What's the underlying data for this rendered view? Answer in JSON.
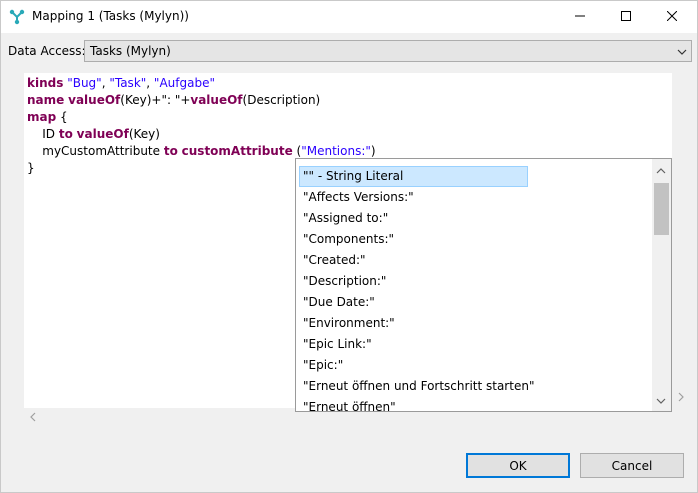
{
  "window": {
    "title": "Mapping 1 (Tasks (Mylyn))",
    "icon": "branch-connector-icon",
    "controls": [
      "minimize-icon",
      "maximize-icon",
      "close-icon"
    ]
  },
  "data_access": {
    "label": "Data Access:",
    "selected": "Tasks (Mylyn)"
  },
  "editor": {
    "lines": [
      [
        {
          "t": "kinds",
          "c": "kw"
        },
        {
          "t": " ",
          "c": "plain"
        },
        {
          "t": "\"Bug\"",
          "c": "str"
        },
        {
          "t": ", ",
          "c": "plain"
        },
        {
          "t": "\"Task\"",
          "c": "str"
        },
        {
          "t": ", ",
          "c": "plain"
        },
        {
          "t": "\"Aufgabe\"",
          "c": "str"
        }
      ],
      [
        {
          "t": "name",
          "c": "kw"
        },
        {
          "t": " ",
          "c": "plain"
        },
        {
          "t": "valueOf",
          "c": "kw"
        },
        {
          "t": "(Key)+\": \"+",
          "c": "plain"
        },
        {
          "t": "valueOf",
          "c": "kw"
        },
        {
          "t": "(Description)",
          "c": "plain"
        }
      ],
      [
        {
          "t": "map",
          "c": "kw"
        },
        {
          "t": " {",
          "c": "plain"
        }
      ],
      [
        {
          "t": "    ID ",
          "c": "plain"
        },
        {
          "t": "to",
          "c": "kw"
        },
        {
          "t": " ",
          "c": "plain"
        },
        {
          "t": "valueOf",
          "c": "kw"
        },
        {
          "t": "(Key)",
          "c": "plain"
        }
      ],
      [
        {
          "t": "    myCustomAttribute ",
          "c": "plain"
        },
        {
          "t": "to",
          "c": "kw"
        },
        {
          "t": " ",
          "c": "plain"
        },
        {
          "t": "customAttribute",
          "c": "kw"
        },
        {
          "t": " (",
          "c": "plain"
        },
        {
          "t": "\"Mentions:\"",
          "c": "str"
        },
        {
          "t": ")",
          "c": "plain"
        }
      ],
      [
        {
          "t": "}",
          "c": "plain"
        }
      ]
    ]
  },
  "completion": {
    "selected_index": 0,
    "items": [
      "\"\" - String Literal",
      "\"Affects Versions:\"",
      "\"Assigned to:\"",
      "\"Components:\"",
      "\"Created:\"",
      "\"Description:\"",
      "\"Due Date:\"",
      "\"Environment:\"",
      "\"Epic Link:\"",
      "\"Epic:\"",
      "\"Erneut öffnen und Fortschritt starten\"",
      "\"Erneut öffnen\""
    ]
  },
  "buttons": {
    "ok": "OK",
    "cancel": "Cancel"
  },
  "colors": {
    "keyword": "#7f0055",
    "string": "#2a00ff",
    "selection": "#cce8ff",
    "default_button_border": "#0078d7"
  }
}
